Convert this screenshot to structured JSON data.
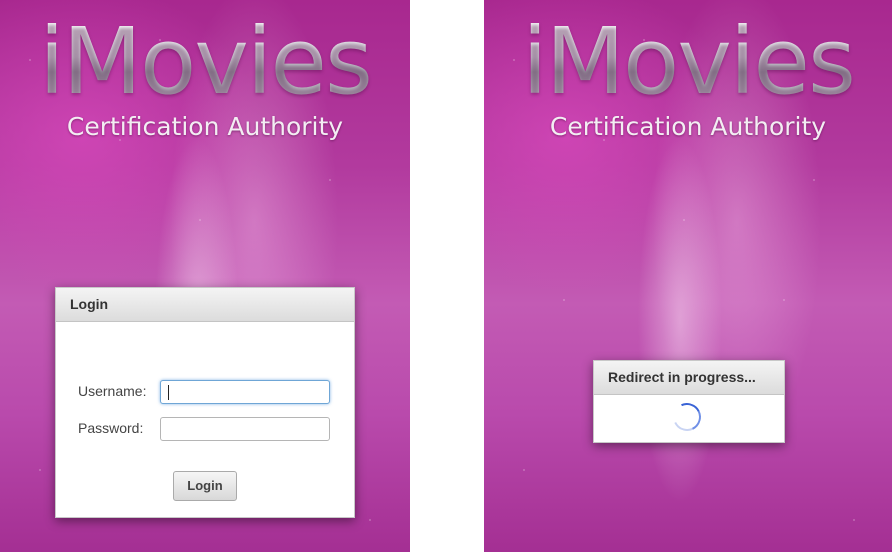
{
  "left_screen": {
    "brand": {
      "title": "iMovies",
      "subtitle": "Certification Authority"
    },
    "login_dialog": {
      "title": "Login",
      "username_label": "Username:",
      "password_label": "Password:",
      "username_value": "",
      "password_value": "",
      "submit_label": "Login"
    }
  },
  "right_screen": {
    "brand": {
      "title": "iMovies",
      "subtitle": "Certification Authority"
    },
    "redirect_dialog": {
      "title": "Redirect in progress..."
    }
  },
  "colors": {
    "background_accent": "#b23a9e",
    "spinner": "#3a64d6"
  }
}
